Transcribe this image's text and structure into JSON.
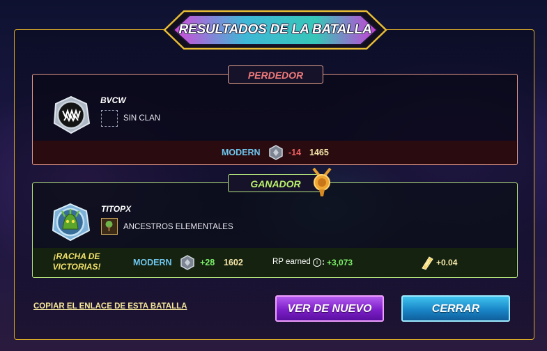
{
  "title": "RESULTADOS DE LA BATALLA",
  "loser": {
    "tag": "PERDEDOR",
    "player_name": "BVCW",
    "guild": "SIN CLAN",
    "avatar_icon": "fanged-mouth-icon",
    "guild_icon": "empty-banner-icon",
    "format": "MODERN",
    "league_icon": "silver-league-icon",
    "rating_change": "-14",
    "rating": "1465"
  },
  "winner": {
    "tag": "GANADOR",
    "player_name": "TITOPX",
    "guild": "ANCESTROS ELEMENTALES",
    "avatar_icon": "green-monster-icon",
    "guild_icon": "tree-banner-icon",
    "win_streak": "¡RACHA DE VICTORIAS!",
    "format": "MODERN",
    "league_icon": "silver-league-icon",
    "rating_change": "+28",
    "rating": "1602",
    "rp_label": "RP earned",
    "rp_value": "+3,073",
    "reward_icon": "energy-shard-icon",
    "reward_value": "+0.04"
  },
  "actions": {
    "copy_link": "COPIAR EL ENLACE DE ESTA BATALLA",
    "replay": "VER DE NUEVO",
    "close": "CERRAR"
  },
  "colors": {
    "frame_gold": "#d9a92a",
    "loser_red": "#f07a7a",
    "winner_green": "#b9f06b",
    "replay_purple": "#7d1fc9",
    "close_blue": "#1a86c8"
  }
}
